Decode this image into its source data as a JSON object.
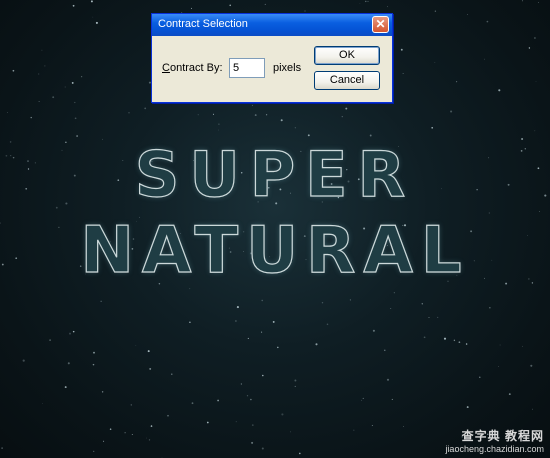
{
  "dialog": {
    "title": "Contract Selection",
    "close_glyph": "✕",
    "contract_label_accel": "C",
    "contract_label_rest": "ontract By:",
    "amount_value": "5",
    "unit_label": "pixels",
    "ok_label": "OK",
    "cancel_label": "Cancel"
  },
  "artwork": {
    "line1": "SUPER",
    "line2": "NATURAL"
  },
  "watermark": {
    "line1": "查字典 教程网",
    "line2": "jiaocheng.chazidian.com"
  },
  "colors": {
    "titlebar": "#0a5fe0",
    "dialog_bg": "#ece9d8",
    "background": "#0f1e24",
    "text_fill": "#1f3d44"
  }
}
